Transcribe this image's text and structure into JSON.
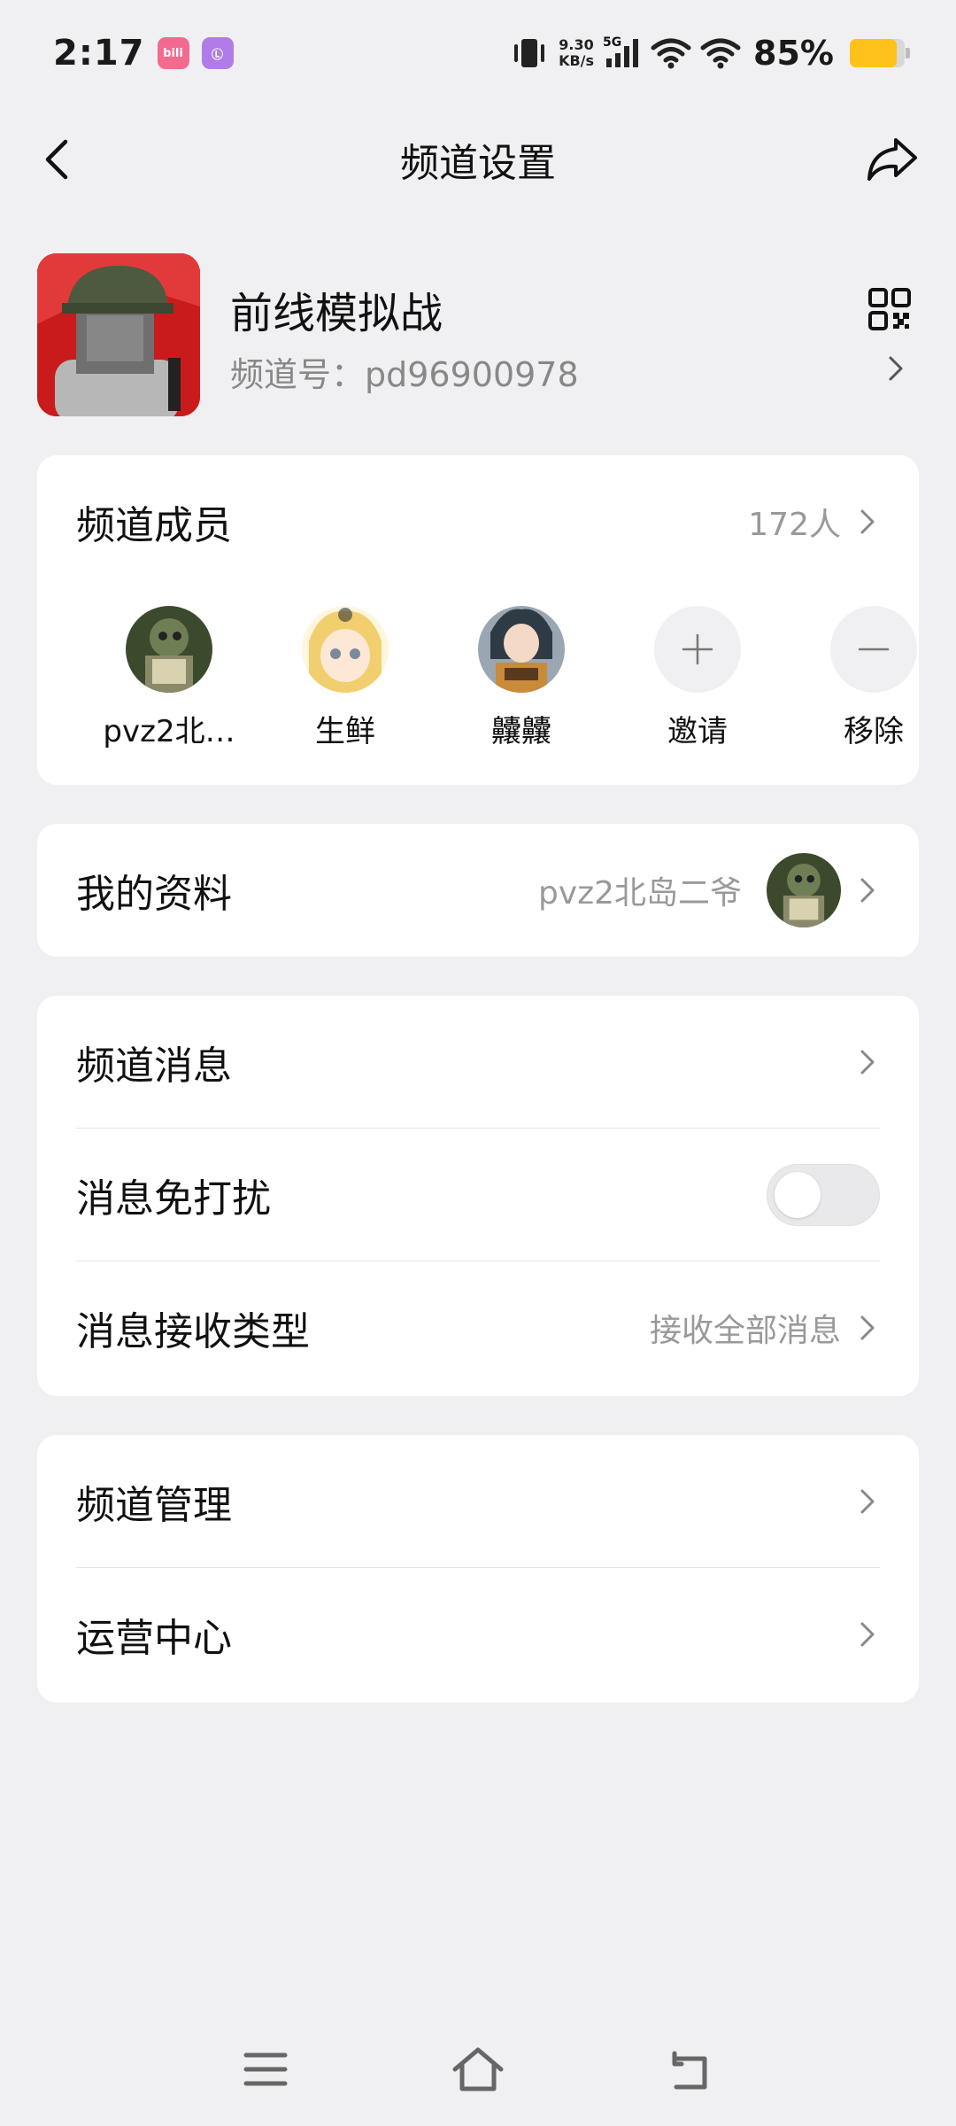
{
  "status_bar": {
    "time": "2:17",
    "app_badge_1": "bili",
    "app_badge_2": "Ⓛ",
    "net_speed_value": "9.30",
    "net_speed_unit": "KB/s",
    "network_type": "5G",
    "battery_percent": "85%",
    "battery_level": 0.85
  },
  "header": {
    "title": "频道设置"
  },
  "channel": {
    "name": "前线模拟战",
    "id_label": "频道号：pd96900978"
  },
  "members": {
    "label": "频道成员",
    "count": "172人",
    "list": [
      {
        "name": "pvz2北…"
      },
      {
        "name": "生鲜"
      },
      {
        "name": "齉齉"
      }
    ],
    "invite_label": "邀请",
    "remove_label": "移除"
  },
  "profile": {
    "label": "我的资料",
    "value": "pvz2北岛二爷"
  },
  "messages": {
    "channel_messages_label": "频道消息",
    "dnd_label": "消息免打扰",
    "dnd_enabled": false,
    "receive_type_label": "消息接收类型",
    "receive_type_value": "接收全部消息"
  },
  "management": {
    "channel_manage_label": "频道管理",
    "ops_center_label": "运营中心"
  },
  "colors": {
    "background": "#f0f0f3",
    "card": "#ffffff",
    "secondary_text": "#999999",
    "battery": "#ffc21a",
    "bili_badge": "#f26b8f",
    "purple_badge": "#b07ce8"
  }
}
